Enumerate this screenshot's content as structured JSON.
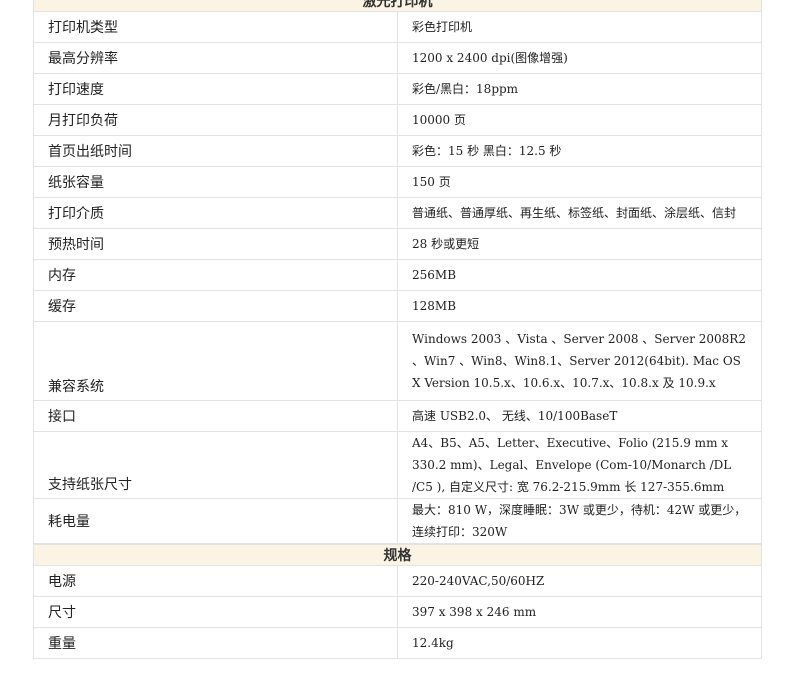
{
  "section_laser": {
    "title": "激光打印机",
    "rows": [
      {
        "label": "打印机类型",
        "value": "彩色打印机"
      },
      {
        "label": "最高分辨率",
        "value": "1200 x 2400 dpi(图像增强)"
      },
      {
        "label": "打印速度",
        "value": "彩色/黑白：18ppm"
      },
      {
        "label": "月打印负荷",
        "value": "10000 页"
      },
      {
        "label": "首页出纸时间",
        "value": "彩色：15 秒 黑白：12.5 秒"
      },
      {
        "label": "纸张容量",
        "value": "150 页"
      },
      {
        "label": "打印介质",
        "value": "普通纸、普通厚纸、再生纸、标签纸、封面纸、涂层纸、信封"
      },
      {
        "label": "预热时间",
        "value": "28 秒或更短"
      },
      {
        "label": "内存",
        "value": "256MB"
      },
      {
        "label": "缓存",
        "value": "128MB"
      },
      {
        "label": "兼容系统",
        "value": "Windows 2003 、Vista 、Server 2008 、Server 2008R2 、Win7 、Win8、Win8.1、Server 2012(64bit). Mac OS X Version 10.5.x、10.6.x、10.7.x、10.8.x 及 10.9.x"
      },
      {
        "label": "接口",
        "value": "高速 USB2.0、 无线、10/100BaseT"
      },
      {
        "label": "支持纸张尺寸",
        "value": "A4、B5、A5、Letter、Executive、Folio (215.9 mm x 330.2 mm)、Legal、Envelope (Com-10/Monarch /DL /C5 ), 自定义尺寸: 宽 76.2-215.9mm 长 127-355.6mm"
      },
      {
        "label": "耗电量",
        "value": "最大：810 W，深度睡眠：3W 或更少，待机：42W 或更少，连续打印：320W"
      }
    ]
  },
  "section_spec": {
    "title": "规格",
    "rows": [
      {
        "label": "电源",
        "value": "220-240VAC,50/60HZ"
      },
      {
        "label": "尺寸",
        "value": "397 x 398 x 246 mm"
      },
      {
        "label": "重量",
        "value": "12.4kg"
      }
    ]
  }
}
